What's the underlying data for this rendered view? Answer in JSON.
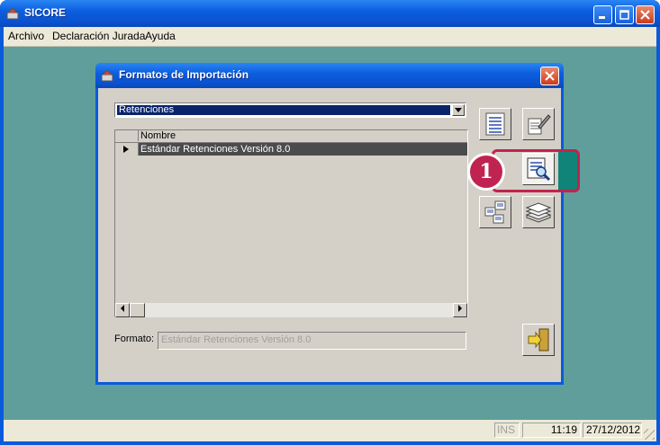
{
  "app": {
    "title": "SICORE"
  },
  "menu": {
    "items": [
      "Archivo",
      "Declaración Jurada",
      "Ayuda"
    ]
  },
  "dialog": {
    "title": "Formatos de Importación",
    "combo_value": "Retenciones",
    "grid": {
      "column_header": "Nombre",
      "rows": [
        "Estándar Retenciones Versión 8.0"
      ]
    },
    "format_label": "Formato:",
    "format_value": "Estándar Retenciones Versión 8.0",
    "tools": [
      "list-document-icon",
      "edit-document-icon",
      "preview-document-icon",
      "tree-structure-icon",
      "stack-icon",
      "exit-door-icon"
    ]
  },
  "callout": {
    "number": "1",
    "color": "#c0234f"
  },
  "status": {
    "ins": "INS",
    "time": "11:19",
    "date": "27/12/2012"
  },
  "colors": {
    "titlebar": "#0a5adc",
    "desktop": "#5f9e9b",
    "selection": "#4b4b4b"
  }
}
